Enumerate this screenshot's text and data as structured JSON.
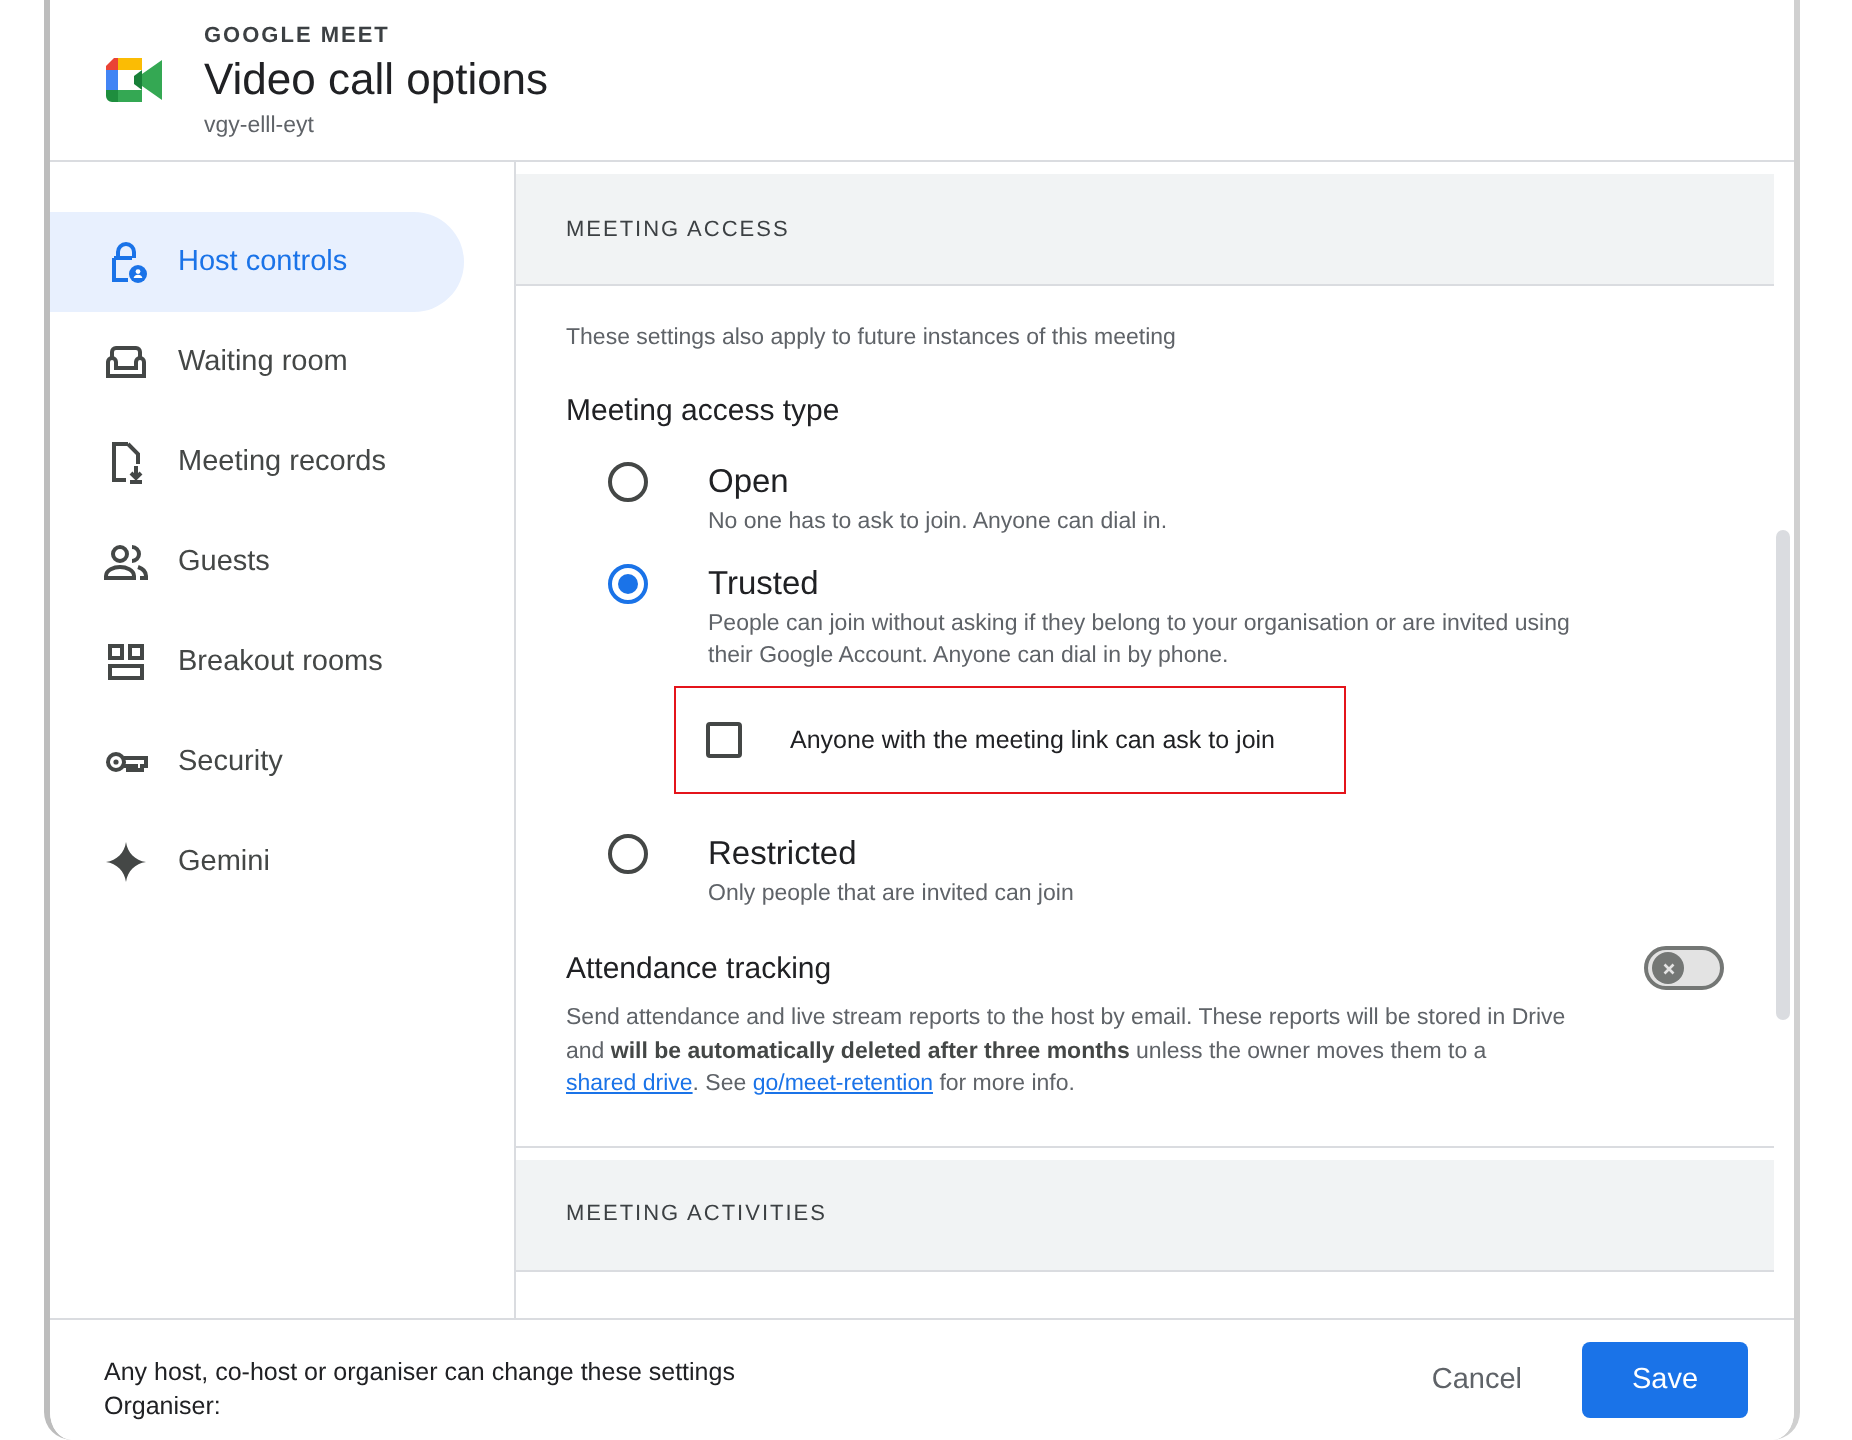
{
  "header": {
    "app_name": "GOOGLE MEET",
    "title": "Video call options",
    "meeting_code": "vgy-elll-eyt"
  },
  "sidebar": {
    "items": [
      {
        "label": "Host controls",
        "selected": true
      },
      {
        "label": "Waiting room",
        "selected": false
      },
      {
        "label": "Meeting records",
        "selected": false
      },
      {
        "label": "Guests",
        "selected": false
      },
      {
        "label": "Breakout rooms",
        "selected": false
      },
      {
        "label": "Security",
        "selected": false
      },
      {
        "label": "Gemini",
        "selected": false
      }
    ]
  },
  "sections": [
    {
      "title": "MEETING ACCESS",
      "note": "These settings also apply to future instances of this meeting",
      "access_type": {
        "label": "Meeting access type",
        "options": [
          {
            "label": "Open",
            "description": "No one has to ask to join. Anyone can dial in.",
            "selected": false
          },
          {
            "label": "Trusted",
            "description": "People can join without asking if they belong to your organisation or are invited using their Google Account. Anyone can dial in by phone.",
            "selected": true,
            "sub_option": {
              "label": "Anyone with the meeting link can ask to join",
              "checked": false,
              "highlighted": true
            }
          },
          {
            "label": "Restricted",
            "description": "Only people that are invited can join",
            "selected": false
          }
        ]
      },
      "attendance": {
        "label": "Attendance tracking",
        "on": false,
        "description": [
          {
            "kind": "text",
            "text": "Send attendance and live stream reports to the host by email. These reports will be stored in Drive and **will be automatically deleted after three months** unless the owner moves them to a "
          },
          {
            "kind": "link",
            "text": "shared drive"
          },
          {
            "kind": "text",
            "text": ". See "
          },
          {
            "kind": "link",
            "text": "go/meet-retention"
          },
          {
            "kind": "text",
            "text": " for more info."
          }
        ]
      }
    },
    {
      "title": "MEETING ACTIVITIES"
    }
  ],
  "footer": {
    "notice": "Any host, co-host or organiser can change these settings",
    "organiser_label": "Organiser:",
    "buttons": [
      {
        "label": "Cancel",
        "kind": "text"
      },
      {
        "label": "Save",
        "kind": "filled"
      }
    ]
  }
}
